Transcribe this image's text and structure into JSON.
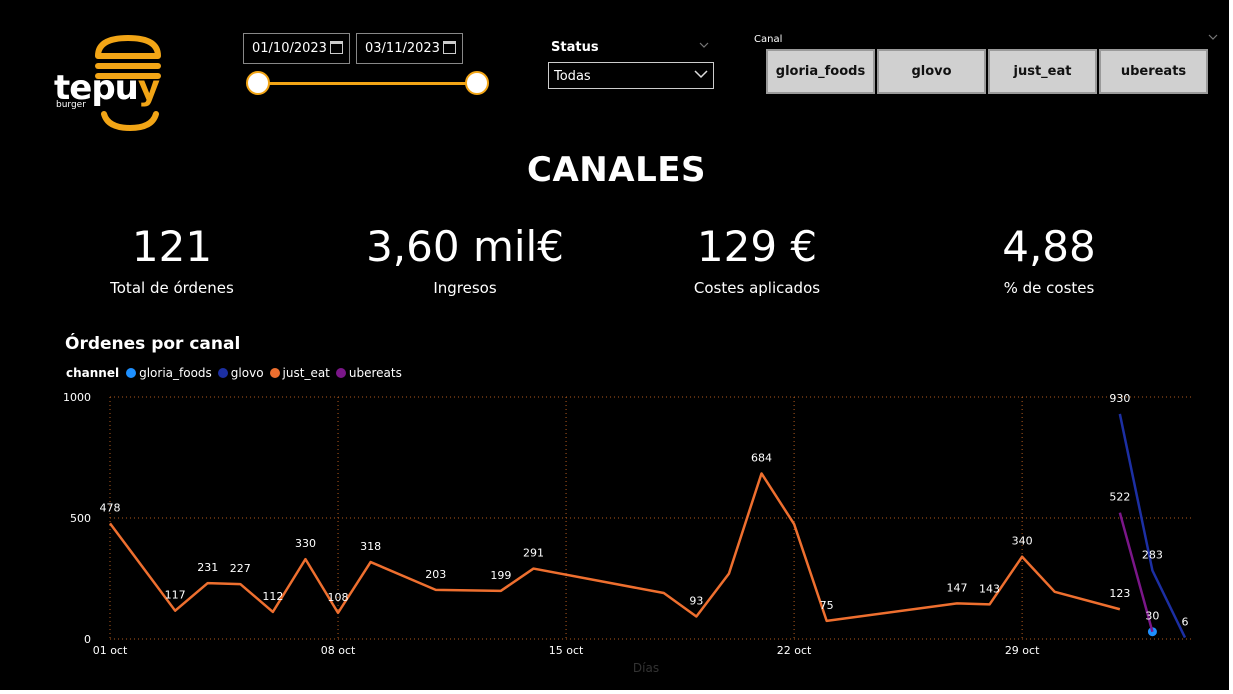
{
  "logo": {
    "text_main": "tepu",
    "text_y": "y",
    "text_sub": "burger"
  },
  "date_filter": {
    "start": "01/10/2023",
    "end": "03/11/2023"
  },
  "status_filter": {
    "title": "Status",
    "selected": "Todas"
  },
  "canal_filter": {
    "title": "Canal",
    "options": [
      "gloria_foods",
      "glovo",
      "just_eat",
      "ubereats"
    ]
  },
  "page_title": "CANALES",
  "kpis": [
    {
      "value": "121",
      "label": "Total de órdenes"
    },
    {
      "value": "3,60 mil€",
      "label": "Ingresos"
    },
    {
      "value": "129 €",
      "label": "Costes aplicados"
    },
    {
      "value": "4,88",
      "label": "% de costes"
    }
  ],
  "colors": {
    "accent": "#f2a516",
    "gloria_foods": "#1e90ff",
    "glovo": "#1c2fa3",
    "just_eat": "#ee6f2f",
    "ubereats": "#7b1689"
  },
  "chart_data": {
    "type": "line",
    "title": "Órdenes por canal",
    "legend_title": "channel",
    "legend_position": "top-left",
    "xlabel": "Días",
    "ylabel": "",
    "ylim": [
      0,
      1000
    ],
    "yticks": [
      0,
      500,
      1000
    ],
    "xlim": [
      "2023-10-01",
      "2023-11-03"
    ],
    "xticks": [
      {
        "date": "2023-10-01",
        "label": "01 oct"
      },
      {
        "date": "2023-10-08",
        "label": "08 oct"
      },
      {
        "date": "2023-10-15",
        "label": "15 oct"
      },
      {
        "date": "2023-10-22",
        "label": "22 oct"
      },
      {
        "date": "2023-10-29",
        "label": "29 oct"
      }
    ],
    "grid": true,
    "series": [
      {
        "name": "gloria_foods",
        "color": "#1e90ff",
        "points": [
          {
            "x": "2023-11-02",
            "y": 30,
            "label": "30"
          }
        ]
      },
      {
        "name": "glovo",
        "color": "#1c2fa3",
        "points": [
          {
            "x": "2023-11-01",
            "y": 930,
            "label": "930"
          },
          {
            "x": "2023-11-02",
            "y": 283,
            "label": "283"
          },
          {
            "x": "2023-11-03",
            "y": 6,
            "label": "6"
          }
        ]
      },
      {
        "name": "just_eat",
        "color": "#ee6f2f",
        "points": [
          {
            "x": "2023-10-01",
            "y": 478,
            "label": "478"
          },
          {
            "x": "2023-10-03",
            "y": 117,
            "label": "117"
          },
          {
            "x": "2023-10-04",
            "y": 231,
            "label": "231"
          },
          {
            "x": "2023-10-05",
            "y": 227,
            "label": "227"
          },
          {
            "x": "2023-10-06",
            "y": 112,
            "label": "112"
          },
          {
            "x": "2023-10-07",
            "y": 330,
            "label": "330"
          },
          {
            "x": "2023-10-08",
            "y": 108,
            "label": "108"
          },
          {
            "x": "2023-10-09",
            "y": 318,
            "label": "318"
          },
          {
            "x": "2023-10-11",
            "y": 203,
            "label": "203"
          },
          {
            "x": "2023-10-13",
            "y": 199,
            "label": "199"
          },
          {
            "x": "2023-10-14",
            "y": 291,
            "label": "291"
          },
          {
            "x": "2023-10-18",
            "y": 190,
            "label": ""
          },
          {
            "x": "2023-10-19",
            "y": 93,
            "label": "93"
          },
          {
            "x": "2023-10-20",
            "y": 270,
            "label": ""
          },
          {
            "x": "2023-10-21",
            "y": 684,
            "label": "684"
          },
          {
            "x": "2023-10-22",
            "y": 475,
            "label": ""
          },
          {
            "x": "2023-10-23",
            "y": 75,
            "label": "75"
          },
          {
            "x": "2023-10-27",
            "y": 147,
            "label": "147"
          },
          {
            "x": "2023-10-28",
            "y": 143,
            "label": "143"
          },
          {
            "x": "2023-10-29",
            "y": 340,
            "label": "340"
          },
          {
            "x": "2023-10-30",
            "y": 195,
            "label": ""
          },
          {
            "x": "2023-11-01",
            "y": 123,
            "label": "123"
          }
        ]
      },
      {
        "name": "ubereats",
        "color": "#7b1689",
        "points": [
          {
            "x": "2023-11-01",
            "y": 522,
            "label": "522"
          },
          {
            "x": "2023-11-02",
            "y": 30,
            "label": ""
          }
        ]
      }
    ]
  }
}
